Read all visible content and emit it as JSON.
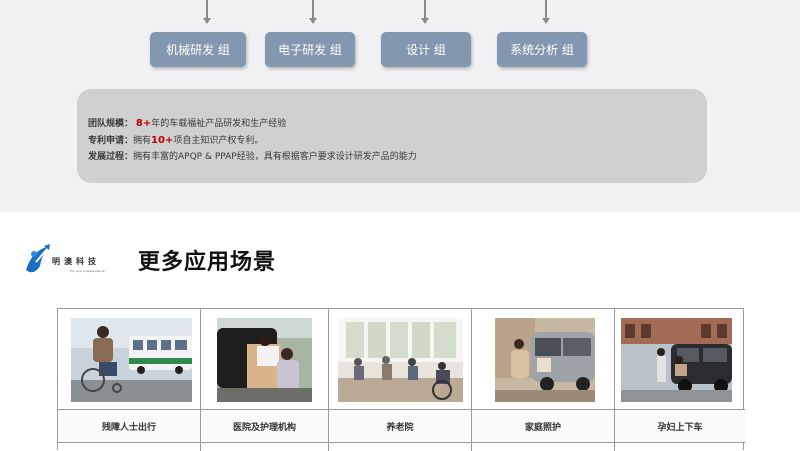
{
  "groups": [
    {
      "label": "机械研发 组"
    },
    {
      "label": "电子研发 组"
    },
    {
      "label": "设计 组"
    },
    {
      "label": "系统分析 组"
    }
  ],
  "team_info": {
    "scale_label": "团队规模：",
    "scale_num": "8+",
    "scale_text": "年的车载福祉产品研发和生产经验",
    "patent_label": "专利申请：",
    "patent_pre": "拥有",
    "patent_num": "10+",
    "patent_text": "项自主知识产权专利。",
    "dev_label": "发展过程：",
    "dev_text": "拥有丰富的APQP & PPAP经验，具有根据客户要求设计研发产品的能力"
  },
  "logo": {
    "name": "明澳科技",
    "tagline": "For your independence"
  },
  "section_title": "更多应用场景",
  "scenes": [
    {
      "label": "残障人士出行"
    },
    {
      "label": "医院及护理机构"
    },
    {
      "label": "养老院"
    },
    {
      "label": "家庭照护"
    },
    {
      "label": "孕妇上下车"
    }
  ],
  "colors": {
    "group_button": "#8497b0",
    "info_box": "#d0d0d2",
    "highlight": "#c00000"
  }
}
